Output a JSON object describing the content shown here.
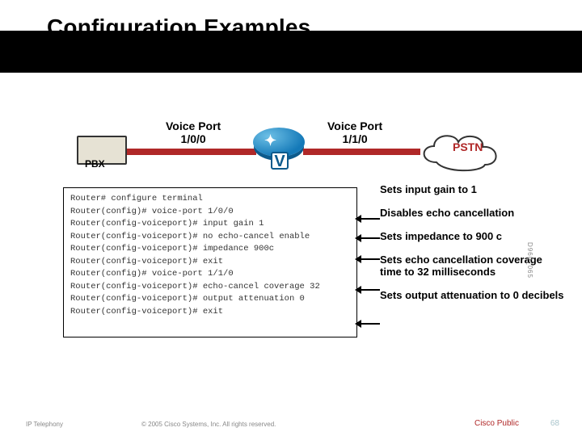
{
  "title": "Configuration Examples",
  "diagram": {
    "pbx_label": "PBX",
    "voice_port_0": {
      "label": "Voice Port",
      "id": "1/0/0"
    },
    "voice_port_1": {
      "label": "Voice Port",
      "id": "1/1/0"
    },
    "router_v": "V",
    "pstn_label": "PSTN"
  },
  "cli": [
    "Router# configure terminal",
    "Router(config)# voice-port 1/0/0",
    "Router(config-voiceport)# input gain 1",
    "Router(config-voiceport)# no echo-cancel enable",
    "Router(config-voiceport)# impedance 900c",
    "Router(config-voiceport)# exit",
    "Router(config)# voice-port 1/1/0",
    "Router(config-voiceport)# echo-cancel coverage 32",
    "Router(config-voiceport)# output attenuation 0",
    "Router(config-voiceport)# exit"
  ],
  "annotations": [
    "Sets input gain to 1",
    "Disables echo cancellation",
    "Sets impedance to 900 c",
    "Sets echo cancellation coverage time to 32 milliseconds",
    "Sets output attenuation to 0 decibels"
  ],
  "side_id": "D960_065",
  "footer": {
    "left": "IP Telephony",
    "copyright": "© 2005 Cisco Systems, Inc. All rights reserved.",
    "cisco_public": "Cisco Public",
    "page": "68"
  }
}
